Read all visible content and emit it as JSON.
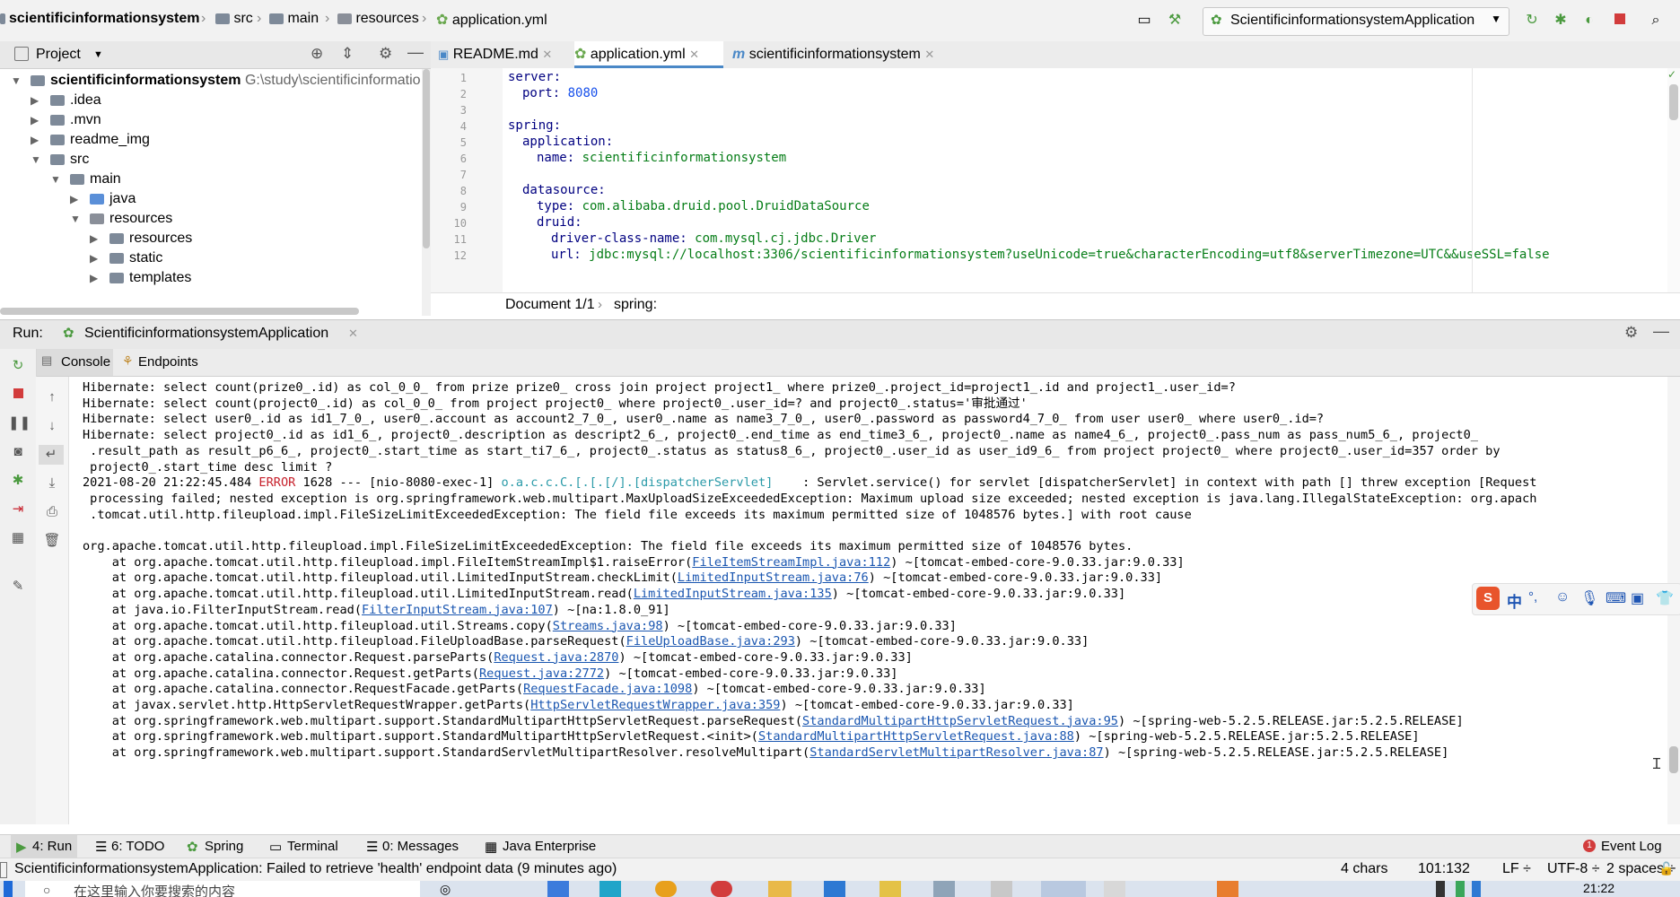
{
  "breadcrumb": {
    "items": [
      "scientificinformationsystem",
      "src",
      "main",
      "resources",
      "application.yml"
    ]
  },
  "toolbar": {
    "run_config": "ScientificinformationsystemApplication"
  },
  "project_panel": {
    "title": "Project",
    "tree": [
      {
        "label": "scientificinformationsystem",
        "path": "G:\\study\\scientificinformatio",
        "depth": 0,
        "expanded": true,
        "icon": "module-folder-icon"
      },
      {
        "label": ".idea",
        "depth": 1,
        "expanded": false,
        "icon": "folder-icon"
      },
      {
        "label": ".mvn",
        "depth": 1,
        "expanded": false,
        "icon": "folder-icon"
      },
      {
        "label": "readme_img",
        "depth": 1,
        "expanded": false,
        "icon": "folder-icon"
      },
      {
        "label": "src",
        "depth": 1,
        "expanded": true,
        "icon": "folder-icon"
      },
      {
        "label": "main",
        "depth": 2,
        "expanded": true,
        "icon": "folder-icon"
      },
      {
        "label": "java",
        "depth": 3,
        "expanded": false,
        "icon": "source-folder-icon"
      },
      {
        "label": "resources",
        "depth": 3,
        "expanded": true,
        "icon": "resources-folder-icon"
      },
      {
        "label": "resources",
        "depth": 4,
        "expanded": false,
        "icon": "folder-icon"
      },
      {
        "label": "static",
        "depth": 4,
        "expanded": false,
        "icon": "folder-icon"
      },
      {
        "label": "templates",
        "depth": 4,
        "expanded": false,
        "icon": "folder-icon"
      }
    ]
  },
  "editor": {
    "tabs": [
      {
        "label": "README.md",
        "active": false
      },
      {
        "label": "application.yml",
        "active": true
      },
      {
        "label": "scientificinformationsystem",
        "active": false
      }
    ],
    "lines": [
      {
        "n": "1",
        "key": "server:",
        "value": "",
        "indent": 0
      },
      {
        "n": "2",
        "key": "port:",
        "value": "8080",
        "indent": 1,
        "num": true
      },
      {
        "n": "3",
        "key": "",
        "value": "",
        "indent": 0
      },
      {
        "n": "4",
        "key": "spring:",
        "value": "",
        "indent": 0
      },
      {
        "n": "5",
        "key": "application:",
        "value": "",
        "indent": 1
      },
      {
        "n": "6",
        "key": "name:",
        "value": "scientificinformationsystem",
        "indent": 2
      },
      {
        "n": "7",
        "key": "",
        "value": "",
        "indent": 0
      },
      {
        "n": "8",
        "key": "datasource:",
        "value": "",
        "indent": 1
      },
      {
        "n": "9",
        "key": "type:",
        "value": "com.alibaba.druid.pool.DruidDataSource",
        "indent": 2
      },
      {
        "n": "10",
        "key": "druid:",
        "value": "",
        "indent": 2
      },
      {
        "n": "11",
        "key": "driver-class-name:",
        "value": "com.mysql.cj.jdbc.Driver",
        "indent": 3
      },
      {
        "n": "12",
        "key": "url:",
        "value": "jdbc:mysql://localhost:3306/scientificinformationsystem?useUnicode=true&characterEncoding=utf8&serverTimezone=UTC&&useSSL=false",
        "indent": 3
      }
    ],
    "breadcrumb": [
      "Document 1/1",
      "spring:"
    ]
  },
  "run_panel": {
    "label": "Run:",
    "config_tab": "ScientificinformationsystemApplication",
    "subtabs": [
      "Console",
      "Endpoints"
    ],
    "console": [
      {
        "segs": [
          {
            "t": "Hibernate: select count(prize0_.id) as col_0_0_ from prize prize0_ cross join project project1_ where prize0_.project_id=project1_.id and project1_.user_id=?"
          }
        ]
      },
      {
        "segs": [
          {
            "t": "Hibernate: select count(project0_.id) as col_0_0_ from project project0_ where project0_.user_id=? and project0_.status='审批通过'"
          }
        ]
      },
      {
        "segs": [
          {
            "t": "Hibernate: select user0_.id as id1_7_0_, user0_.account as account2_7_0_, user0_.name as name3_7_0_, user0_.password as password4_7_0_ from user user0_ where user0_.id=?"
          }
        ]
      },
      {
        "segs": [
          {
            "t": "Hibernate: select project0_.id as id1_6_, project0_.description as descript2_6_, project0_.end_time as end_time3_6_, project0_.name as name4_6_, project0_.pass_num as pass_num5_6_, project0_"
          }
        ]
      },
      {
        "segs": [
          {
            "t": " .result_path as result_p6_6_, project0_.start_time as start_ti7_6_, project0_.status as status8_6_, project0_.user_id as user_id9_6_ from project project0_ where project0_.user_id=357 order by"
          }
        ]
      },
      {
        "segs": [
          {
            "t": " project0_.start_time desc limit ?"
          }
        ]
      },
      {
        "segs": [
          {
            "t": "2021-08-20 21:22:45.484 "
          },
          {
            "t": "ERROR",
            "c": "err"
          },
          {
            "t": " 1628 --- [nio-8080-exec-1] "
          },
          {
            "t": "o.a.c.c.C.[.[.[/].[dispatcherServlet]",
            "c": "cyan"
          },
          {
            "t": "    : Servlet.service() for servlet [dispatcherServlet] in context with path [] threw exception [Request"
          }
        ]
      },
      {
        "segs": [
          {
            "t": " processing failed; nested exception is org.springframework.web.multipart.MaxUploadSizeExceededException: Maximum upload size exceeded; nested exception is java.lang.IllegalStateException: org.apach"
          }
        ]
      },
      {
        "segs": [
          {
            "t": " .tomcat.util.http.fileupload.impl.FileSizeLimitExceededException: The field file exceeds its maximum permitted size of 1048576 bytes.] with root cause"
          }
        ]
      },
      {
        "segs": [
          {
            "t": ""
          }
        ]
      },
      {
        "segs": [
          {
            "t": "org.apache.tomcat.util.http.fileupload.impl.FileSizeLimitExceededException: The field file exceeds its maximum permitted size of 1048576 bytes."
          }
        ]
      },
      {
        "segs": [
          {
            "t": "    at org.apache.tomcat.util.http.fileupload.impl.FileItemStreamImpl$1.raiseError("
          },
          {
            "t": "FileItemStreamImpl.java:112",
            "c": "lnk"
          },
          {
            "t": ") ~[tomcat-embed-core-9.0.33.jar:9.0.33]"
          }
        ]
      },
      {
        "segs": [
          {
            "t": "    at org.apache.tomcat.util.http.fileupload.util.LimitedInputStream.checkLimit("
          },
          {
            "t": "LimitedInputStream.java:76",
            "c": "lnk"
          },
          {
            "t": ") ~[tomcat-embed-core-9.0.33.jar:9.0.33]"
          }
        ]
      },
      {
        "segs": [
          {
            "t": "    at org.apache.tomcat.util.http.fileupload.util.LimitedInputStream.read("
          },
          {
            "t": "LimitedInputStream.java:135",
            "c": "lnk"
          },
          {
            "t": ") ~[tomcat-embed-core-9.0.33.jar:9.0.33]"
          }
        ]
      },
      {
        "segs": [
          {
            "t": "    at java.io.FilterInputStream.read("
          },
          {
            "t": "FilterInputStream.java:107",
            "c": "lnk"
          },
          {
            "t": ") ~[na:1.8.0_91]"
          }
        ]
      },
      {
        "segs": [
          {
            "t": "    at org.apache.tomcat.util.http.fileupload.util.Streams.copy("
          },
          {
            "t": "Streams.java:98",
            "c": "lnk"
          },
          {
            "t": ") ~[tomcat-embed-core-9.0.33.jar:9.0.33]"
          }
        ]
      },
      {
        "segs": [
          {
            "t": "    at org.apache.tomcat.util.http.fileupload.FileUploadBase.parseRequest("
          },
          {
            "t": "FileUploadBase.java:293",
            "c": "lnk"
          },
          {
            "t": ") ~[tomcat-embed-core-9.0.33.jar:9.0.33]"
          }
        ]
      },
      {
        "segs": [
          {
            "t": "    at org.apache.catalina.connector.Request.parseParts("
          },
          {
            "t": "Request.java:2870",
            "c": "lnk"
          },
          {
            "t": ") ~[tomcat-embed-core-9.0.33.jar:9.0.33]"
          }
        ]
      },
      {
        "segs": [
          {
            "t": "    at org.apache.catalina.connector.Request.getParts("
          },
          {
            "t": "Request.java:2772",
            "c": "lnk"
          },
          {
            "t": ") ~[tomcat-embed-core-9.0.33.jar:9.0.33]"
          }
        ]
      },
      {
        "segs": [
          {
            "t": "    at org.apache.catalina.connector.RequestFacade.getParts("
          },
          {
            "t": "RequestFacade.java:1098",
            "c": "lnk"
          },
          {
            "t": ") ~[tomcat-embed-core-9.0.33.jar:9.0.33]"
          }
        ]
      },
      {
        "segs": [
          {
            "t": "    at javax.servlet.http.HttpServletRequestWrapper.getParts("
          },
          {
            "t": "HttpServletRequestWrapper.java:359",
            "c": "lnk"
          },
          {
            "t": ") ~[tomcat-embed-core-9.0.33.jar:9.0.33]"
          }
        ]
      },
      {
        "segs": [
          {
            "t": "    at org.springframework.web.multipart.support.StandardMultipartHttpServletRequest.parseRequest("
          },
          {
            "t": "StandardMultipartHttpServletRequest.java:95",
            "c": "lnk"
          },
          {
            "t": ") ~[spring-web-5.2.5.RELEASE.jar:5.2.5.RELEASE]"
          }
        ]
      },
      {
        "segs": [
          {
            "t": "    at org.springframework.web.multipart.support.StandardMultipartHttpServletRequest.<init>("
          },
          {
            "t": "StandardMultipartHttpServletRequest.java:88",
            "c": "lnk"
          },
          {
            "t": ") ~[spring-web-5.2.5.RELEASE.jar:5.2.5.RELEASE]"
          }
        ]
      },
      {
        "segs": [
          {
            "t": "    at org.springframework.web.multipart.support.StandardServletMultipartResolver.resolveMultipart("
          },
          {
            "t": "StandardServletMultipartResolver.java:87",
            "c": "lnk"
          },
          {
            "t": ") ~[spring-web-5.2.5.RELEASE.jar:5.2.5.RELEASE]"
          }
        ]
      }
    ]
  },
  "tool_windows": {
    "run": "4: Run",
    "todo": "6: TODO",
    "spring": "Spring",
    "terminal": "Terminal",
    "messages": "0: Messages",
    "java_enterprise": "Java Enterprise",
    "event_log_count": "1",
    "event_log": "Event Log"
  },
  "status_bar": {
    "message": "ScientificinformationsystemApplication: Failed to retrieve 'health' endpoint data (9 minutes ago)",
    "chars": "4 chars",
    "position": "101:132",
    "line_sep": "LF",
    "encoding": "UTF-8",
    "indent": "2 spaces"
  },
  "ime": {
    "lang": "中",
    "punct": "°,"
  },
  "taskbar": {
    "search_placeholder": "在这里输入你要搜索的内容",
    "time": "21:22"
  },
  "colors": {
    "accent": "#4a88c7",
    "error": "#c7222d",
    "link": "#1a56b0",
    "logger": "#2a9aa8"
  }
}
